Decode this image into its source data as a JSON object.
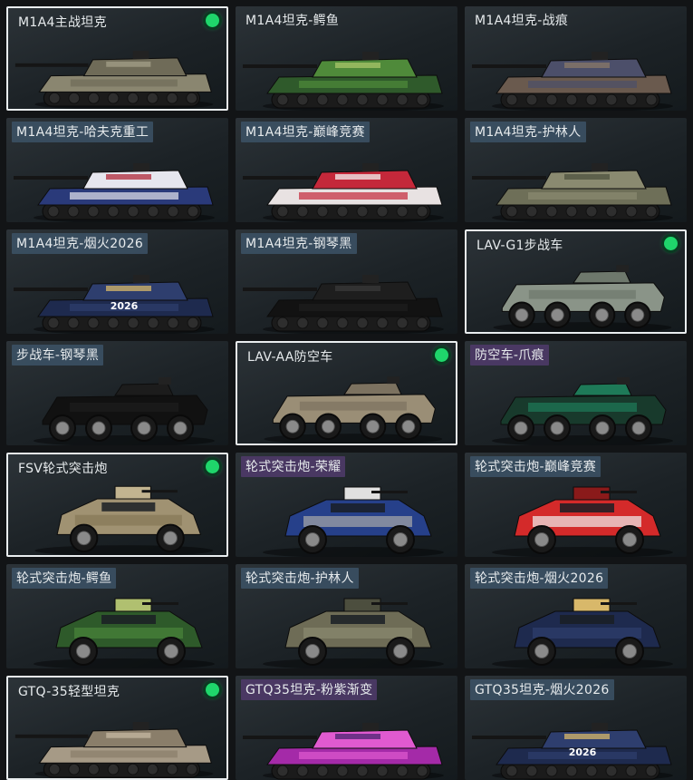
{
  "vehicles": [
    {
      "label": "M1A4主战坦克",
      "type": "tank",
      "tag": "plain",
      "selected": true,
      "equipped": true,
      "colors": [
        "#8a8670",
        "#6f6b58",
        "#a39f88"
      ]
    },
    {
      "label": "M1A4坦克-鳄鱼",
      "type": "tank",
      "tag": "plain",
      "selected": false,
      "equipped": false,
      "colors": [
        "#2f5a2b",
        "#4f8a3a",
        "#a8c46a"
      ]
    },
    {
      "label": "M1A4坦克-战痕",
      "type": "tank",
      "tag": "plain",
      "selected": false,
      "equipped": false,
      "colors": [
        "#6a5a4e",
        "#4c4f6a",
        "#8a7868"
      ]
    },
    {
      "label": "M1A4坦克-哈夫克重工",
      "type": "tank",
      "tag": "blue",
      "selected": false,
      "equipped": false,
      "colors": [
        "#2a3a7a",
        "#e6e6ee",
        "#b02a3a"
      ]
    },
    {
      "label": "M1A4坦克-巅峰竞赛",
      "type": "tank",
      "tag": "blue",
      "selected": false,
      "equipped": false,
      "colors": [
        "#e8e2e2",
        "#c4283a",
        "#f2f2f2"
      ]
    },
    {
      "label": "M1A4坦克-护林人",
      "type": "tank",
      "tag": "blue",
      "selected": false,
      "equipped": false,
      "colors": [
        "#6e6f58",
        "#8a8a70",
        "#4e513f"
      ]
    },
    {
      "label": "M1A4坦克-烟火2026",
      "type": "tank",
      "tag": "blue",
      "selected": false,
      "equipped": false,
      "colors": [
        "#1e2a4e",
        "#2e3e6e",
        "#d8b86a"
      ],
      "decal": "2026"
    },
    {
      "label": "M1A4坦克-钢琴黑",
      "type": "tank",
      "tag": "blue",
      "selected": false,
      "equipped": false,
      "colors": [
        "#121212",
        "#1e1e1e",
        "#3a3a3a"
      ]
    },
    {
      "label": "LAV-G1步战车",
      "type": "apc",
      "tag": "plain",
      "selected": true,
      "equipped": true,
      "colors": [
        "#8a9488",
        "#6e786c",
        "#a8b0a4"
      ]
    },
    {
      "label": "步战车-钢琴黑",
      "type": "apc",
      "tag": "blue",
      "selected": false,
      "equipped": false,
      "colors": [
        "#111111",
        "#1c1c1c",
        "#333333"
      ]
    },
    {
      "label": "LAV-AA防空车",
      "type": "apc",
      "tag": "plain",
      "selected": true,
      "equipped": true,
      "colors": [
        "#9a8e76",
        "#7c7260",
        "#b4a890"
      ]
    },
    {
      "label": "防空车-爪痕",
      "type": "apc",
      "tag": "purple",
      "selected": false,
      "equipped": false,
      "colors": [
        "#183a2c",
        "#1e7a58",
        "#0e2a20"
      ]
    },
    {
      "label": "FSV轮式突击炮",
      "type": "armored-car",
      "tag": "plain",
      "selected": true,
      "equipped": true,
      "colors": [
        "#a09272",
        "#857856",
        "#c2b490"
      ]
    },
    {
      "label": "轮式突击炮-荣耀",
      "type": "armored-car",
      "tag": "purple",
      "selected": false,
      "equipped": false,
      "colors": [
        "#26408a",
        "#a8a8a8",
        "#e0e0e0"
      ]
    },
    {
      "label": "轮式突击炮-巅峰竞赛",
      "type": "armored-car",
      "tag": "blue",
      "selected": false,
      "equipped": false,
      "colors": [
        "#d42a2a",
        "#f0f0f0",
        "#8a1a1a"
      ]
    },
    {
      "label": "轮式突击炮-鳄鱼",
      "type": "armored-car",
      "tag": "blue",
      "selected": false,
      "equipped": false,
      "colors": [
        "#2e5a2a",
        "#4a843a",
        "#b0c070"
      ]
    },
    {
      "label": "轮式突击炮-护林人",
      "type": "armored-car",
      "tag": "blue",
      "selected": false,
      "equipped": false,
      "colors": [
        "#6e6c56",
        "#8a8a70",
        "#4c4e3e"
      ]
    },
    {
      "label": "轮式突击炮-烟火2026",
      "type": "armored-car",
      "tag": "blue",
      "selected": false,
      "equipped": false,
      "colors": [
        "#1e2a4e",
        "#2e3e6e",
        "#d8b86a"
      ]
    },
    {
      "label": "GTQ-35轻型坦克",
      "type": "light-tank",
      "tag": "plain",
      "selected": true,
      "equipped": true,
      "colors": [
        "#a69a86",
        "#8a7e6a",
        "#c4b8a2"
      ]
    },
    {
      "label": "GTQ35坦克-粉紫渐变",
      "type": "light-tank",
      "tag": "purple",
      "selected": false,
      "equipped": false,
      "colors": [
        "#a42aa8",
        "#e05ad0",
        "#4a2470"
      ]
    },
    {
      "label": "GTQ35坦克-烟火2026",
      "type": "light-tank",
      "tag": "blue",
      "selected": false,
      "equipped": false,
      "colors": [
        "#1e2a4e",
        "#2e3e6e",
        "#d8b86a"
      ],
      "decal": "2026"
    }
  ]
}
